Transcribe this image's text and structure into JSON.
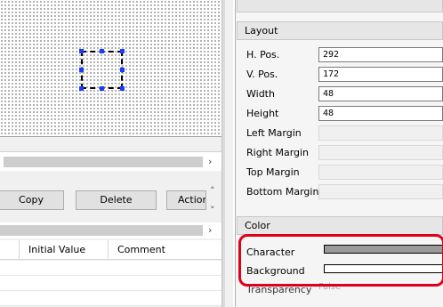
{
  "toolbar": {
    "copy": "Copy",
    "delete": "Delete",
    "action": "Actior"
  },
  "table": {
    "columns": [
      "Initial Value",
      "Comment"
    ],
    "rows": 3
  },
  "props": {
    "layout_header": "Layout",
    "fields": [
      {
        "label": "H. Pos.",
        "value": "292"
      },
      {
        "label": "V. Pos.",
        "value": "172"
      },
      {
        "label": "Width",
        "value": "48"
      },
      {
        "label": "Height",
        "value": "48"
      },
      {
        "label": "Left Margin",
        "value": ""
      },
      {
        "label": "Right Margin",
        "value": ""
      },
      {
        "label": "Top Margin",
        "value": ""
      },
      {
        "label": "Bottom Margin",
        "value": ""
      }
    ],
    "color_header": "Color",
    "character_label": "Character",
    "background_label": "Background",
    "character_color": "#9a9a9a",
    "background_color": "#ffffff",
    "transparency_label": "Transparency",
    "transparency_value": "False"
  }
}
